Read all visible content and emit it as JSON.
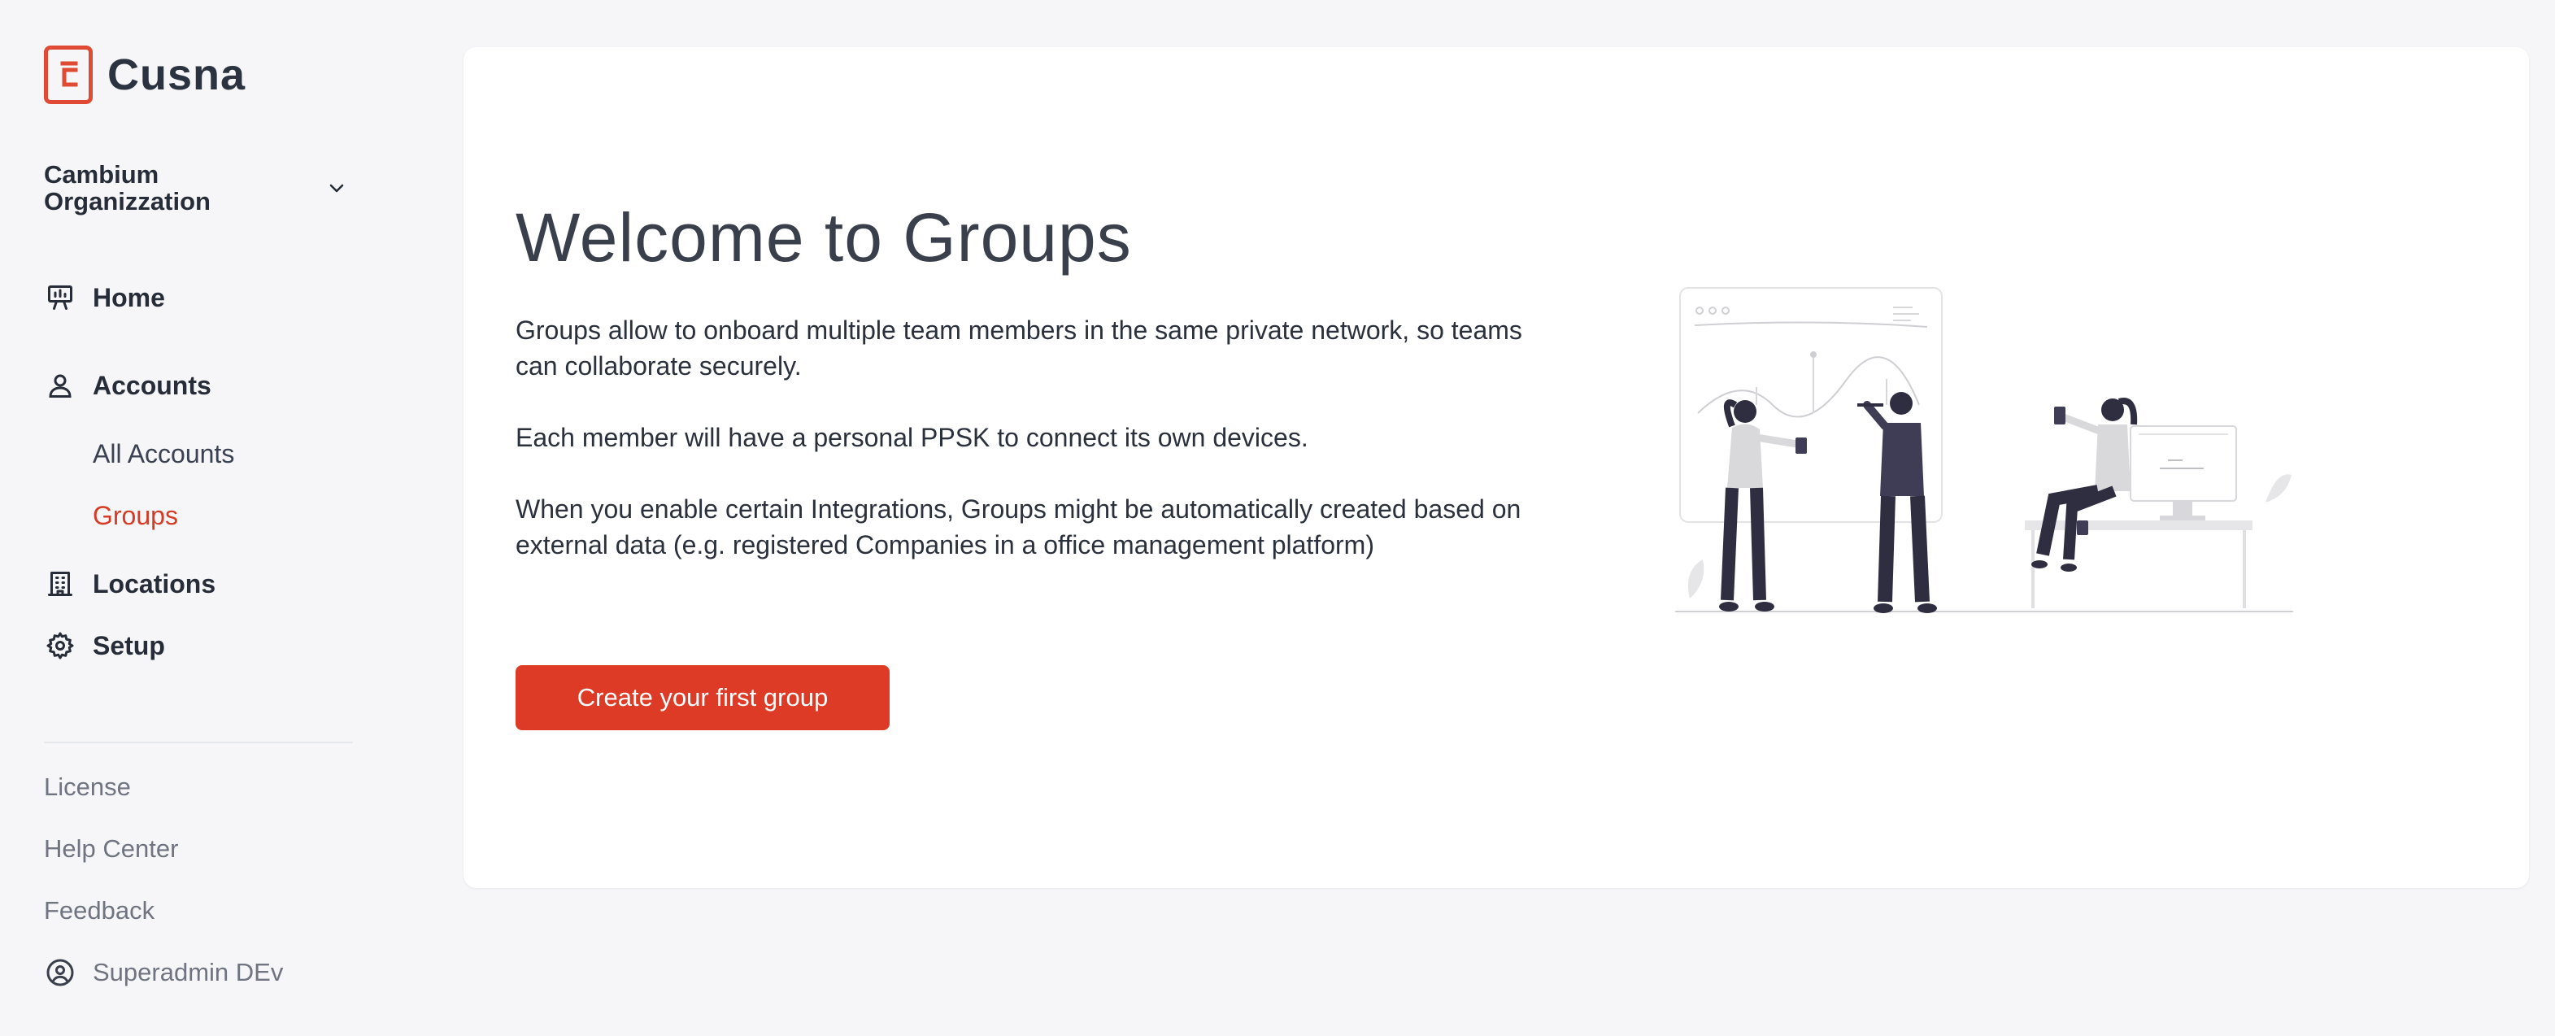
{
  "brand": {
    "name": "Cusna",
    "logo_icon": "cusna-logo-icon",
    "accent": "#e04a35"
  },
  "org": {
    "name": "Cambium Organizzation",
    "chevron_icon": "chevron-down-icon"
  },
  "nav": {
    "home": {
      "label": "Home",
      "icon": "presentation-board-icon"
    },
    "accounts": {
      "label": "Accounts",
      "icon": "user-icon"
    },
    "all_accounts": {
      "label": "All Accounts"
    },
    "groups": {
      "label": "Groups",
      "active_color": "#d63b25"
    },
    "locations": {
      "label": "Locations",
      "icon": "building-icon"
    },
    "setup": {
      "label": "Setup",
      "icon": "gear-icon"
    }
  },
  "footer": {
    "license": "License",
    "help": "Help Center",
    "feedback": "Feedback",
    "user": {
      "name": "Superadmin DEv",
      "icon": "user-circle-icon"
    }
  },
  "main": {
    "title": "Welcome to Groups",
    "p1": "Groups allow to onboard multiple team members in the same private network, so teams can collaborate securely.",
    "p2": "Each member will have a personal PPSK to connect its own devices.",
    "p3": "When you enable certain Integrations, Groups might be automatically created based on external data (e.g. registered Companies in a office management platform)",
    "cta": "Create your first group",
    "cta_color": "#de3b26",
    "illustration": "team-collaboration-illustration"
  }
}
